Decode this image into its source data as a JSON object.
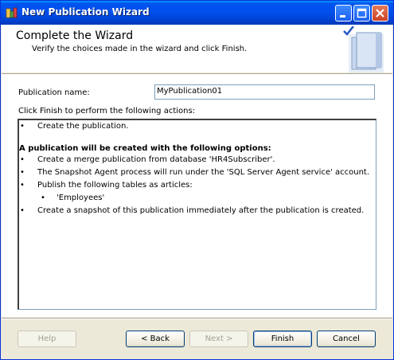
{
  "window": {
    "title": "New Publication Wizard",
    "controls": [
      "minimize-icon",
      "maximize-icon",
      "close-icon"
    ]
  },
  "header": {
    "title": "Complete the Wizard",
    "subtitle": "Verify the choices made in the wizard and click Finish.",
    "graphic_icon": "wizard-book-checkmark-icon"
  },
  "form": {
    "publication_name_label": "Publication name:",
    "publication_name_value": "MyPublication01",
    "actions_label": "Click Finish to perform the following actions:"
  },
  "actions": {
    "bullet": "•",
    "item1": "Create the publication.",
    "options_heading": "A publication will be created with the following options:",
    "option1": "Create a merge publication from database 'HR4Subscriber'.",
    "option2": "The Snapshot Agent process will run under the 'SQL Server Agent service' account.",
    "option3": "Publish the following tables as articles:",
    "option3_sub1": "'Employees'",
    "option4": "Create a snapshot of this publication immediately after the publication is created."
  },
  "buttons": {
    "help": "Help",
    "back": "< Back",
    "next": "Next >",
    "finish": "Finish",
    "cancel": "Cancel"
  },
  "colors": {
    "titlebar": "#0053ee",
    "dialog_bg": "#ece9d8",
    "input_border": "#7f9db9"
  }
}
